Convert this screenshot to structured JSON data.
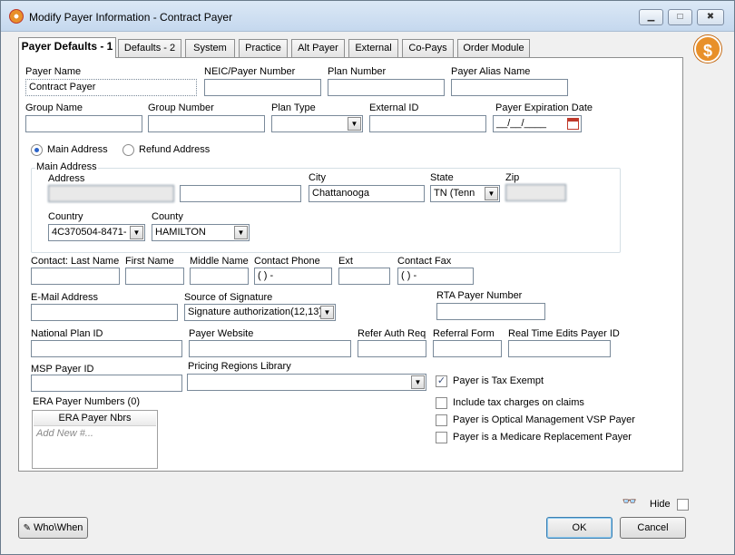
{
  "window": {
    "title": "Modify Payer Information - Contract Payer",
    "minimize": "▁",
    "maximize": "□",
    "close": "✖"
  },
  "logo_text": "$",
  "tabs": [
    "Payer Defaults - 1",
    "Defaults - 2",
    "System",
    "Practice",
    "Alt Payer",
    "External",
    "Co-Pays",
    "Order Module"
  ],
  "labels": {
    "payer_name": "Payer Name",
    "neic": "NEIC/Payer Number",
    "plan_number": "Plan Number",
    "alias": "Payer Alias Name",
    "group_name": "Group Name",
    "group_number": "Group Number",
    "plan_type": "Plan Type",
    "external_id": "External ID",
    "expiration": "Payer Expiration Date",
    "main_address_radio": "Main Address",
    "refund_address_radio": "Refund Address",
    "main_address_group": "Main Address",
    "address": "Address",
    "city": "City",
    "state": "State",
    "zip": "Zip",
    "country": "Country",
    "county": "County",
    "contact_last": "Contact:  Last Name",
    "first_name": "First Name",
    "middle_name": "Middle Name",
    "contact_phone": "Contact Phone",
    "ext": "Ext",
    "contact_fax": "Contact Fax",
    "email": "E-Mail Address",
    "source_sig": "Source of Signature",
    "rta": "RTA Payer Number",
    "national_plan": "National Plan ID",
    "website": "Payer Website",
    "refer_auth": "Refer Auth Req",
    "referral_form": "Referral Form",
    "realtime": "Real Time Edits Payer ID",
    "msp": "MSP Payer ID",
    "pricing": "Pricing Regions Library",
    "era": "ERA Payer Numbers (0)"
  },
  "values": {
    "payer_name": "Contract Payer",
    "expiration": "__/__/____",
    "city": "Chattanooga",
    "state": "TN  (Tenn",
    "country": "4C370504-8471-",
    "county": "HAMILTON",
    "contact_phone": "(  )    -",
    "contact_fax": "(  )    -",
    "source_sig": "Signature authorization(12,13)"
  },
  "era_list": {
    "header": "ERA Payer Nbrs",
    "add_new": "Add New #..."
  },
  "checkboxes": [
    {
      "label": "Payer is Tax Exempt",
      "checked": true
    },
    {
      "label": "Include tax charges on claims",
      "checked": false
    },
    {
      "label": "Payer is Optical Management VSP Payer",
      "checked": false
    },
    {
      "label": "Payer is a Medicare Replacement Payer",
      "checked": false
    }
  ],
  "footer": {
    "who_when": "Who\\When",
    "hide": "Hide",
    "ok": "OK",
    "cancel": "Cancel"
  }
}
